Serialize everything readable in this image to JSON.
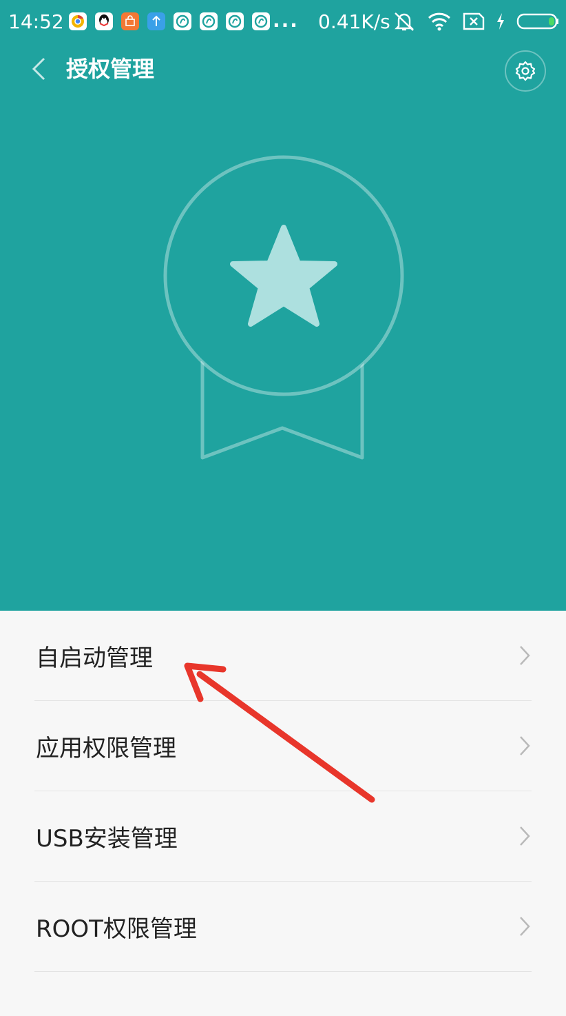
{
  "status_bar": {
    "time": "14:52",
    "more": "...",
    "speed": "0.41K/s",
    "icons": [
      "chrome-icon",
      "qq-icon",
      "mi-store-icon",
      "upload-icon",
      "fish-app-icon",
      "fish-app-icon",
      "fish-app-icon",
      "fish-app-icon"
    ],
    "right_icons": [
      "mute-icon",
      "wifi-icon",
      "no-sim-icon",
      "charging-icon",
      "battery-icon"
    ]
  },
  "header": {
    "title": "授权管理",
    "back_icon": "chevron-left-icon",
    "settings_icon": "gear-icon"
  },
  "hero": {
    "icon": "medal-star-icon"
  },
  "menu": {
    "items": [
      {
        "label": "自启动管理"
      },
      {
        "label": "应用权限管理"
      },
      {
        "label": "USB安装管理"
      },
      {
        "label": "ROOT权限管理"
      }
    ]
  },
  "annotation": {
    "icon": "red-arrow-icon",
    "target": "自启动管理"
  },
  "colors": {
    "primary": "#1fa39f",
    "list_background": "#f7f7f7",
    "arrow": "#e8362b"
  }
}
